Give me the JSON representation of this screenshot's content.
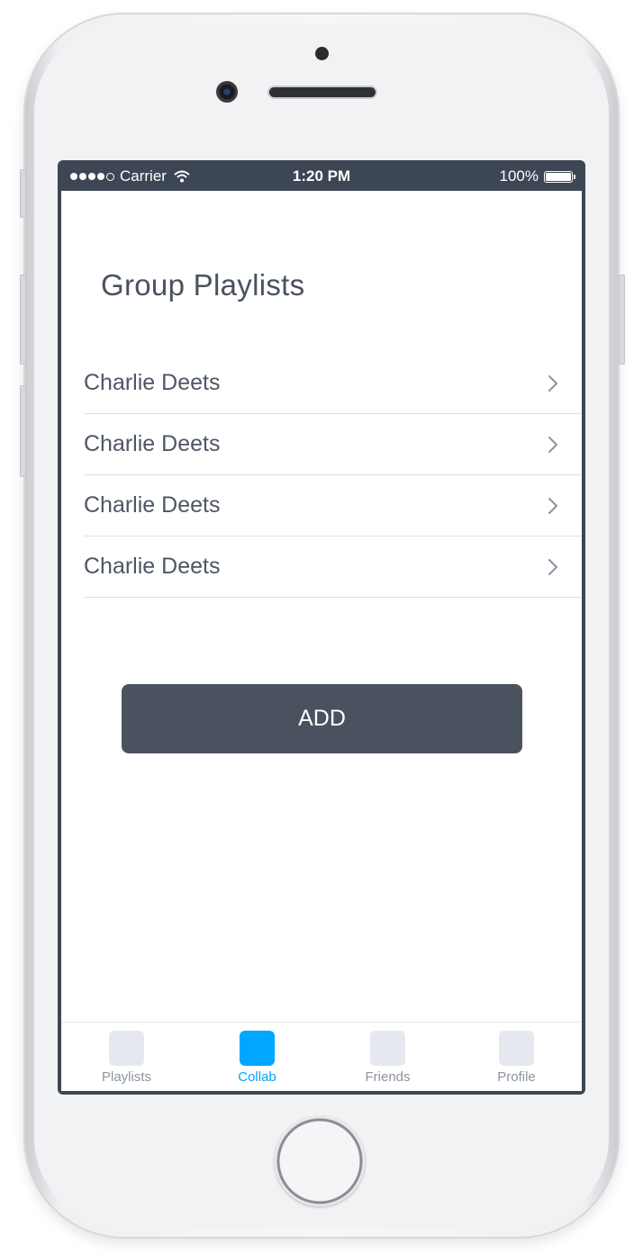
{
  "status_bar": {
    "carrier": "Carrier",
    "time": "1:20 PM",
    "battery": "100%"
  },
  "page": {
    "title": "Group Playlists"
  },
  "playlists": [
    {
      "label": "Charlie Deets"
    },
    {
      "label": "Charlie Deets"
    },
    {
      "label": "Charlie Deets"
    },
    {
      "label": "Charlie Deets"
    }
  ],
  "add_button": {
    "label": "ADD"
  },
  "tabs": [
    {
      "label": "Playlists",
      "active": false
    },
    {
      "label": "Collab",
      "active": true
    },
    {
      "label": "Friends",
      "active": false
    },
    {
      "label": "Profile",
      "active": false
    }
  ],
  "colors": {
    "accent": "#00a6ff",
    "dark": "#4a5260",
    "status_bar": "#3d4654"
  }
}
